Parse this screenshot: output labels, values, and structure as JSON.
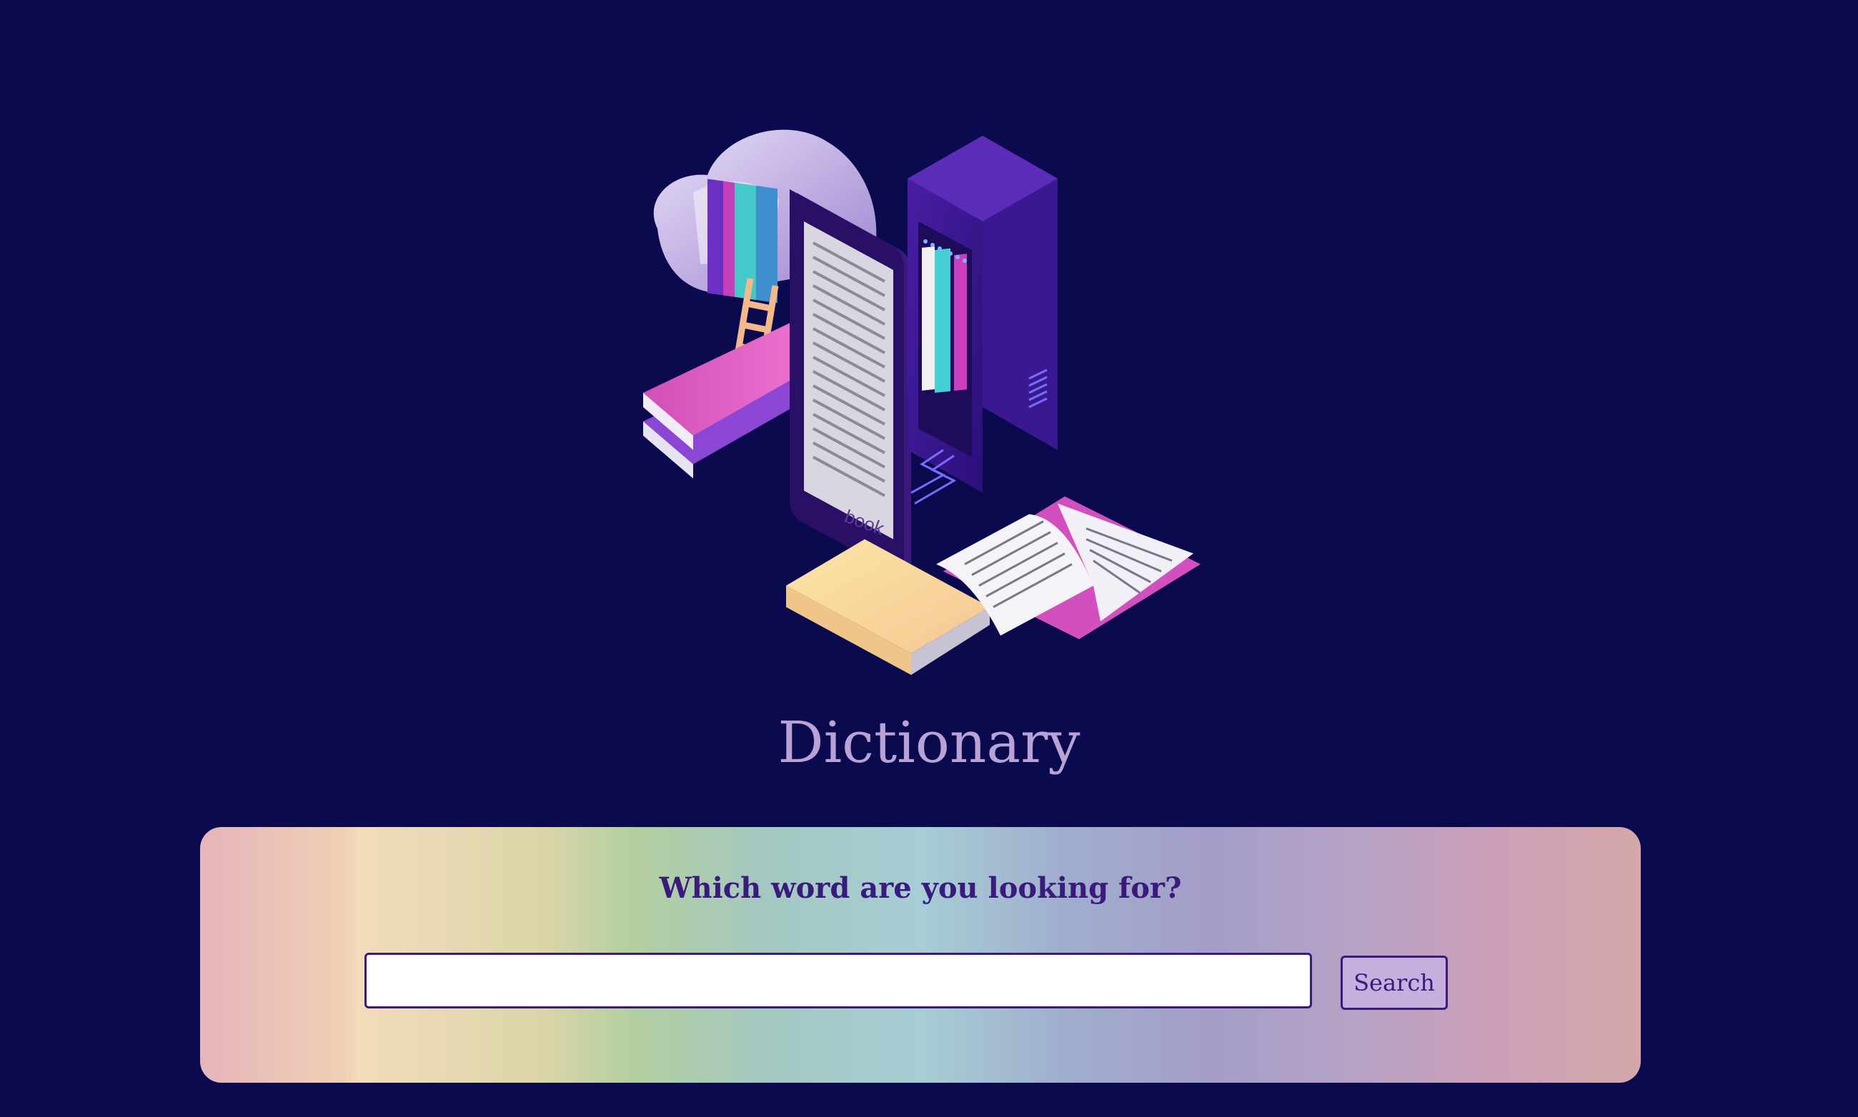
{
  "app": {
    "title": "Dictionary"
  },
  "hero": {
    "illustration": "isometric-books-ebook-cloud-server-illustration",
    "ereader_brand_text": "book"
  },
  "search": {
    "prompt": "Which word are you looking for?",
    "input_value": "",
    "input_placeholder": "",
    "button_label": "Search"
  },
  "colors": {
    "background": "#0b0a4f",
    "title": "#b8a2d6",
    "accent": "#3b1a7e",
    "button_bg": "#c6aedd"
  }
}
